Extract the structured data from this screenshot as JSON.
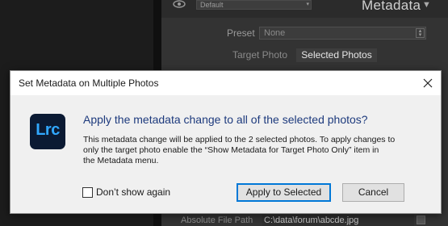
{
  "background": {
    "panel_title": "Metadata",
    "preset_top_value": "Default",
    "preset_label": "Preset",
    "preset_value": "None",
    "seg_target": "Target Photo",
    "seg_selected": "Selected Photos",
    "file_label": "Absolute File Path",
    "file_value": "C:\\data\\forum\\abcde.jpg"
  },
  "dialog": {
    "title": "Set Metadata on Multiple Photos",
    "logo_text": "Lrc",
    "question": "Apply the metadata change to all of the selected photos?",
    "detail_lines": [
      "This metadata change will be applied to the 2 selected photos. To apply changes to",
      "only the target photo enable the “Show Metadata for Target Photo Only” item in",
      "the Metadata menu."
    ],
    "dont_show_label": "Don’t show again",
    "apply_label": "Apply to Selected",
    "cancel_label": "Cancel"
  },
  "colors": {
    "question_text": "#1d3a7d",
    "logo_bg": "#0b1a33",
    "logo_fg": "#31a8ff",
    "default_button_border": "#0078d7"
  }
}
